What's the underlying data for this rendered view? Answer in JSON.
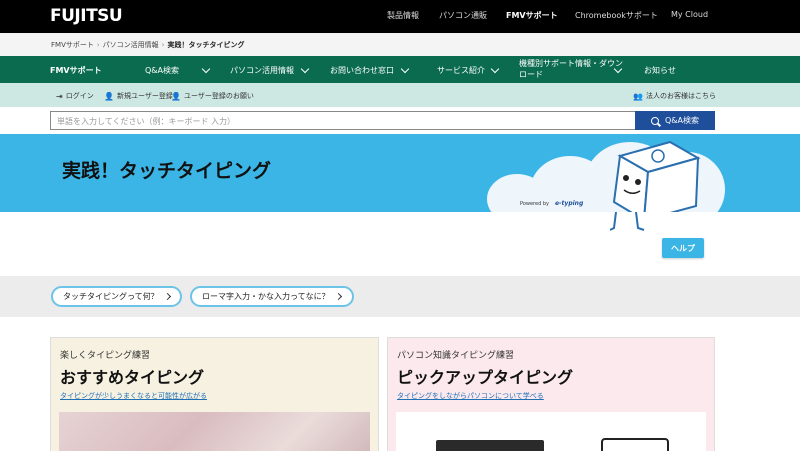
{
  "header": {
    "logo": "FUJITSU",
    "nav": [
      "製品情報",
      "パソコン通販",
      "FMVサポート",
      "Chromebookサポート",
      "My Cloud"
    ]
  },
  "breadcrumb": [
    "FMVサポート",
    "パソコン活用情報",
    "実践！タッチタイピング"
  ],
  "support_nav": {
    "brand": "FMVサポート",
    "items": [
      "Q&A検索",
      "パソコン活用情報",
      "お問い合わせ窓口",
      "サービス紹介",
      "機種別サポート情報・ダウンロード",
      "お知らせ"
    ]
  },
  "account_bar": {
    "login": "ログイン",
    "register": "新規ユーザー登録",
    "user_register": "ユーザー登録のお願い",
    "corporate": "法人のお客様はこちら"
  },
  "search": {
    "placeholder": "単語を入力してください（例：キーボード 入力）",
    "button": "Q&A検索"
  },
  "banner": {
    "title": "実践！タッチタイピング",
    "powered_by": "Powered by",
    "partner": "e-typing"
  },
  "help_button": "ヘルプ",
  "faq_links": [
    "タッチタイピングって何？",
    "ローマ字入力・かな入力ってなに？"
  ],
  "cards": [
    {
      "subtitle": "楽しくタイピング練習",
      "title": "おすすめタイピング",
      "link": "タイピングが少しうまくなると可能性が広がる"
    },
    {
      "subtitle": "パソコン知識タイピング練習",
      "title": "ピックアップタイピング",
      "link": "タイピングをしながらパソコンについて学べる"
    }
  ],
  "colors": {
    "top_bar": "#000000",
    "support_nav": "#0b6b4e",
    "account_bar": "#cde8e3",
    "banner": "#3ab5e6",
    "search_button": "#1f4e9a"
  }
}
